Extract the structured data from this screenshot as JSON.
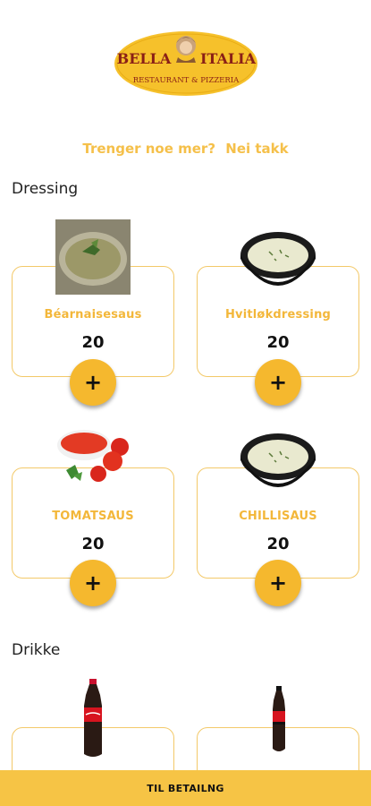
{
  "brand": {
    "name_left": "BELLA",
    "name_right": "ITALIA",
    "subtitle": "RESTAURANT & PIZZERIA"
  },
  "prompt": {
    "question": "Trenger noe mer?",
    "decline": "Nei takk"
  },
  "sections": [
    {
      "title": "Dressing",
      "items": [
        {
          "name": "Béarnaisesaus",
          "price": "20",
          "icon": "bearnaise-sauce-photo"
        },
        {
          "name": "Hvitløkdressing",
          "price": "20",
          "icon": "garlic-dressing-photo"
        },
        {
          "name": "TOMATSAUS",
          "price": "20",
          "icon": "tomato-sauce-photo"
        },
        {
          "name": "CHILLISAUS",
          "price": "20",
          "icon": "chilli-sauce-photo"
        }
      ]
    },
    {
      "title": "Drikke",
      "items": [
        {
          "icon": "coca-cola-bottle-photo"
        },
        {
          "icon": "coca-cola-zero-bottle-photo"
        }
      ]
    }
  ],
  "add_label": "+",
  "checkout": {
    "label": "TIL BETAILNG"
  },
  "colors": {
    "accent": "#f5b82e",
    "card_border": "#f3c969",
    "text_accent": "#f3b73a"
  }
}
